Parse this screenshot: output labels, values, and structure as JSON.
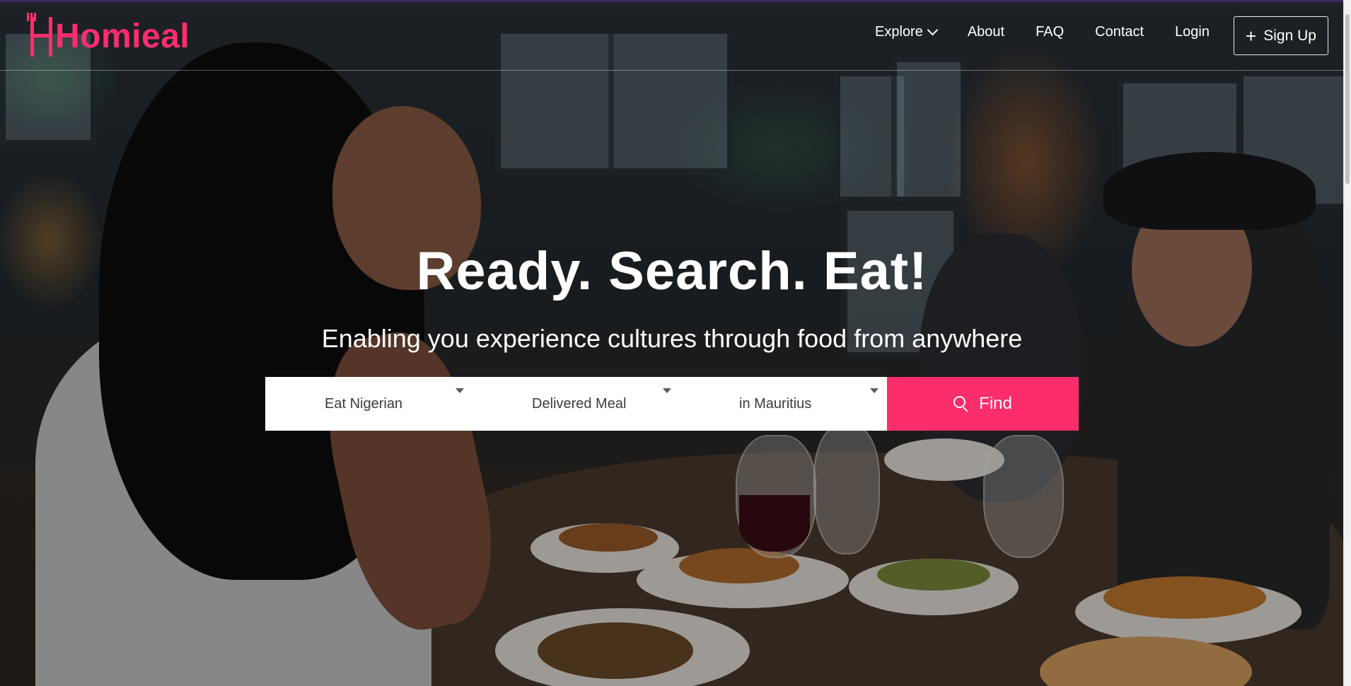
{
  "brand": {
    "name": "Homieal",
    "accent": "#ff2d6f"
  },
  "nav": {
    "items": [
      {
        "label": "Explore",
        "icon": "chevron-down-icon"
      },
      {
        "label": "About"
      },
      {
        "label": "FAQ"
      },
      {
        "label": "Contact"
      },
      {
        "label": "Login"
      }
    ],
    "signup": {
      "label": "Sign Up",
      "icon": "plus-icon"
    }
  },
  "hero": {
    "headline": "Ready. Search. Eat!",
    "subtitle": "Enabling you experience cultures through food from anywhere"
  },
  "search": {
    "cuisine": "Eat Nigerian",
    "meal_type": "Delivered Meal",
    "location": "in Mauritius",
    "find_label": "Find",
    "find_color": "#fb2d6b"
  }
}
